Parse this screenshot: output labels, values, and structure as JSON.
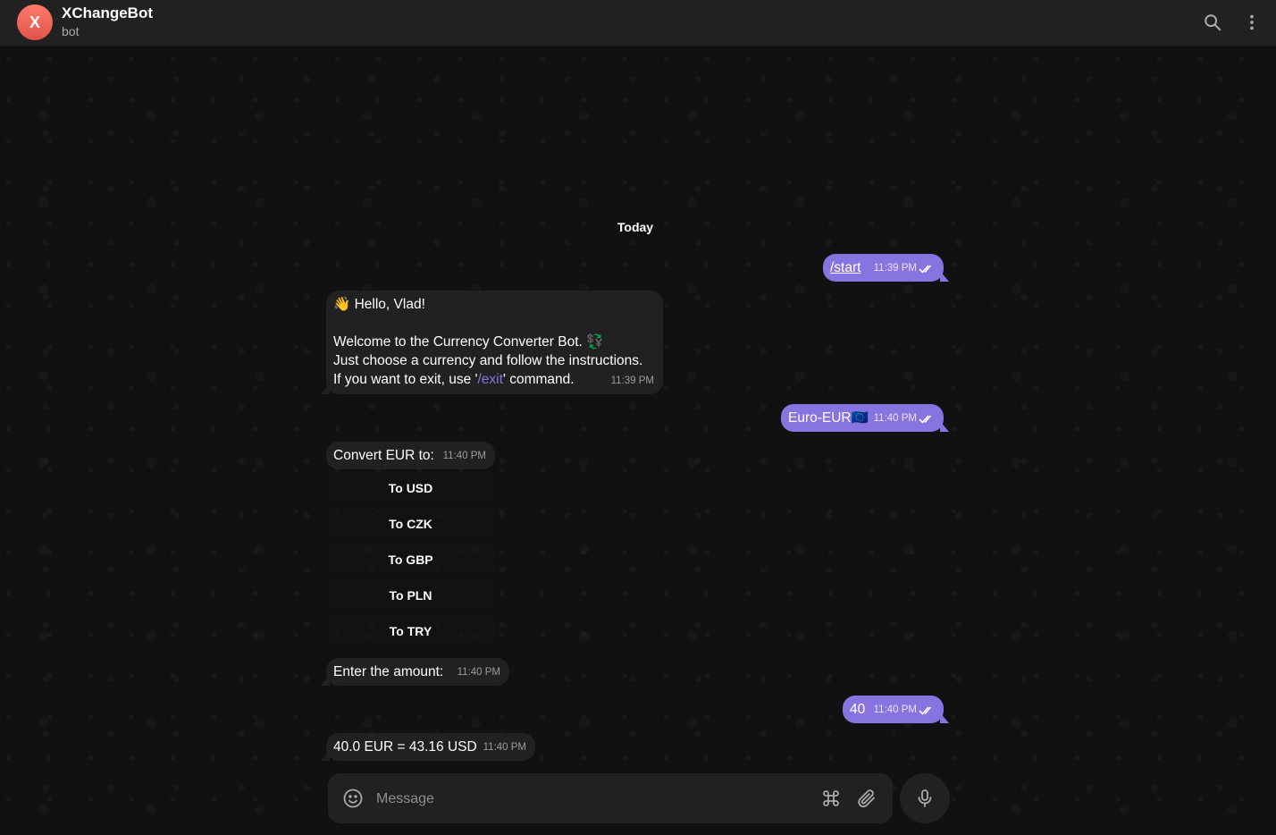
{
  "header": {
    "avatar_letter": "X",
    "title": "XChangeBot",
    "subtitle": "bot",
    "search_icon": "search-icon",
    "menu_icon": "more-vertical-icon"
  },
  "chat": {
    "date_separator": "Today",
    "messages": [
      {
        "id": "m1",
        "dir": "out",
        "text": "/start",
        "time": "11:39 PM",
        "status": "read"
      },
      {
        "id": "m2",
        "dir": "in",
        "lines": [
          "👋 Hello, Vlad!",
          "",
          "Welcome to the Currency Converter Bot. 💱",
          "Just choose a currency and follow the instructions.",
          "If you want to exit, use '",
          "/exit",
          "' command."
        ],
        "time": "11:39 PM"
      },
      {
        "id": "m3",
        "dir": "out",
        "text": "Euro-EUR🇪🇺",
        "time": "11:40 PM",
        "status": "read"
      },
      {
        "id": "m4",
        "dir": "in",
        "text": "Convert EUR to:",
        "time": "11:40 PM",
        "keyboard": [
          "To USD",
          "To CZK",
          "To GBP",
          "To PLN",
          "To TRY"
        ]
      },
      {
        "id": "m5",
        "dir": "in",
        "text": "Enter the amount:",
        "time": "11:40 PM"
      },
      {
        "id": "m6",
        "dir": "out",
        "text": "40",
        "time": "11:40 PM",
        "status": "read"
      },
      {
        "id": "m7",
        "dir": "in",
        "text": "40.0 EUR = 43.16 USD",
        "time": "11:40 PM"
      }
    ]
  },
  "composer": {
    "placeholder": "Message",
    "emoji_icon": "smile-icon",
    "commands_icon": "command-icon",
    "attach_icon": "paperclip-icon",
    "mic_icon": "microphone-icon"
  },
  "colors": {
    "accent": "#8774e1",
    "bubble_in": "#212121",
    "header": "#212121",
    "avatar": "#e0534a"
  }
}
